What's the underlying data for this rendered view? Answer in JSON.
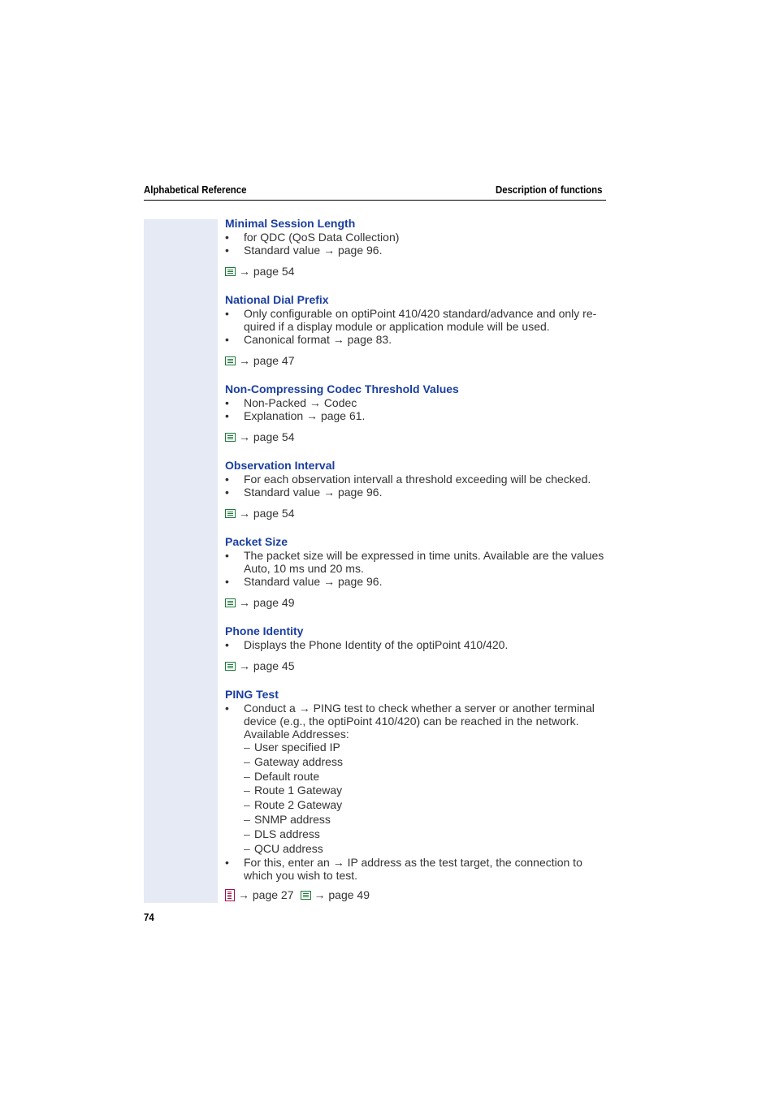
{
  "header": {
    "left": "Alphabetical Reference",
    "right": "Description of functions"
  },
  "arrow": "→",
  "sections": [
    {
      "title": "Minimal Session Length",
      "bullets": [
        "for QDC (QoS Data Collection)",
        "Standard value → page 96."
      ],
      "ref": "→ page 54"
    },
    {
      "title": "National Dial Prefix",
      "bullets": [
        "Only configurable on optiPoint 410/420 standard/advance and only re-quired if a display module or application module will be used.",
        "Canonical format → page 83."
      ],
      "ref": "→ page 47"
    },
    {
      "title": "Non-Compressing Codec Threshold Values",
      "bullets": [
        "Non-Packed → Codec",
        "Explanation → page 61."
      ],
      "ref": "→ page 54"
    },
    {
      "title": "Observation Interval",
      "bullets": [
        "For each observation intervall a threshold exceeding will be checked.",
        "Standard value → page 96."
      ],
      "ref": "→ page 54"
    },
    {
      "title": "Packet Size",
      "bullets": [
        "The packet size will be expressed in time units. Available are the values Auto, 10 ms und 20 ms.",
        "Standard value → page 96."
      ],
      "ref": "→ page 49"
    },
    {
      "title": "Phone Identity",
      "bullets": [
        "Displays the Phone Identity of the optiPoint 410/420."
      ],
      "ref": "→ page 45"
    }
  ],
  "ping": {
    "title": "PING Test",
    "bullet1": "Conduct a → PING test to check whether a server or another terminal device (e.g., the optiPoint 410/420) can be reached in the network. Available Addresses:",
    "addresses": [
      "User specified IP",
      "Gateway address",
      "Default route",
      "Route 1 Gateway",
      "Route 2 Gateway",
      "SNMP address",
      "DLS address",
      "QCU address"
    ],
    "bullet2": "For this, enter an → IP address as the test target, the connection to which you wish to test.",
    "ref1": "→ page 27",
    "ref2": "→ page 49"
  },
  "page_number": "74"
}
